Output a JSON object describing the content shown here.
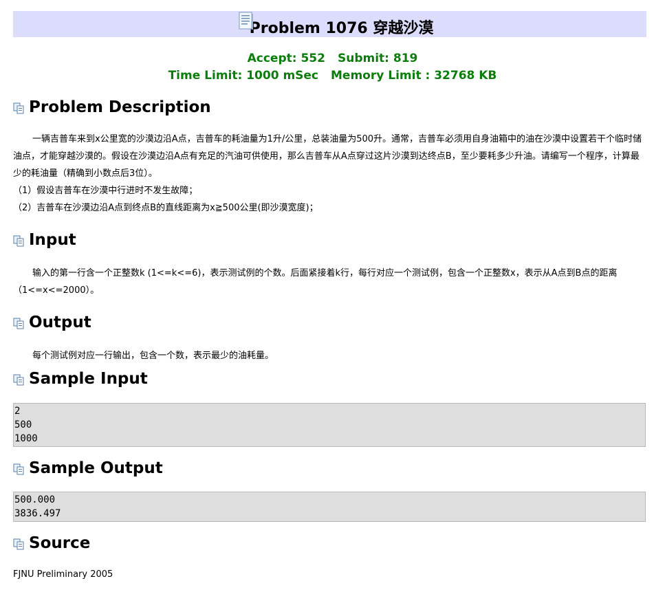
{
  "header": {
    "title": "Problem 1076 穿越沙漠",
    "icon": "document-icon"
  },
  "stats": {
    "accept_label": "Accept: 552",
    "submit_label": "Submit: 819",
    "time_limit_label": "Time Limit: 1000 mSec",
    "memory_limit_label": "Memory Limit : 32768 KB",
    "color": "#0b7d0b"
  },
  "sections": {
    "description": {
      "heading": "Problem Description",
      "icon": "copy-pages-icon",
      "lines": [
        "一辆吉普车来到x公里宽的沙漠边沿A点，吉普车的耗油量为1升/公里，总装油量为500升。通常，吉普车必须用自身油箱中的油在沙漠中设置若干个临时储油点，才能穿越沙漠的。假设在沙漠边沿A点有充足的汽油可供使用，那么吉普车从A点穿过这片沙漠到达终点B，至少要耗多少升油。请编写一个程序，计算最少的耗油量（精确到小数点后3位）。",
        "（1）假设吉普车在沙漠中行进时不发生故障；",
        "（2）吉普车在沙漠边沿A点到终点B的直线距离为x≧500公里(即沙漠宽度)；"
      ]
    },
    "input": {
      "heading": "Input",
      "icon": "copy-pages-icon",
      "text": "输入的第一行含一个正整数k (1<=k<=6)，表示测试例的个数。后面紧接着k行，每行对应一个测试例，包含一个正整数x，表示从A点到B点的距离（1<=x<=2000）。"
    },
    "output": {
      "heading": "Output",
      "icon": "copy-pages-icon",
      "text": "每个测试例对应一行输出，包含一个数，表示最少的油耗量。"
    },
    "sample_input": {
      "heading": "Sample Input",
      "icon": "copy-pages-icon",
      "lines": [
        "2",
        "500",
        "1000"
      ]
    },
    "sample_output": {
      "heading": "Sample Output",
      "icon": "copy-pages-icon",
      "lines": [
        "500.000",
        "3836.497"
      ]
    },
    "source": {
      "heading": "Source",
      "icon": "copy-pages-icon",
      "text": "FJNU Preliminary 2005"
    }
  }
}
